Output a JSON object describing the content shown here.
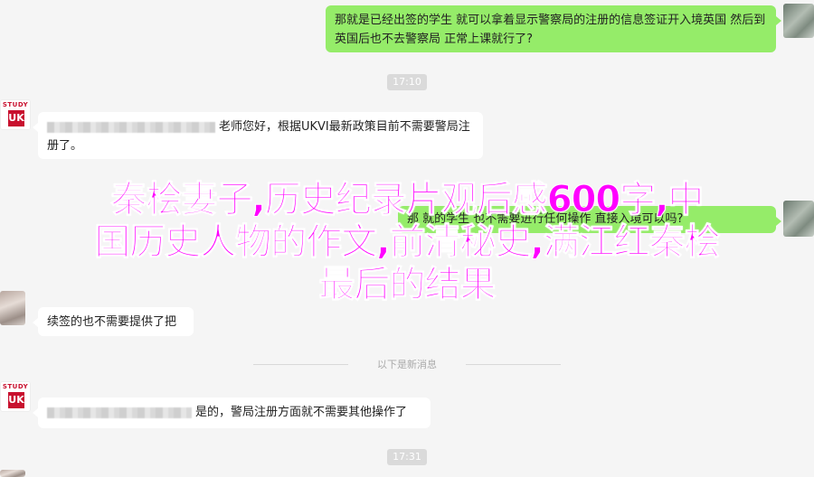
{
  "messages": {
    "m1": "那就是已经出签的学生 就可以拿着显示警察局的注册的信息签证开入境英国 然后到英国后也不去警察局 正常上课就行了?",
    "m2": "老师您好，根据UKVI最新政策目前不需要警局注册了。",
    "m3_partial_a": "那",
    "m3_partial_b": "就的学生",
    "m3_partial_c": "也不需要进行任何操作",
    "m3_partial_d": "直接入境可以吗?",
    "m4": "续签的也不需要提供了把",
    "m5": "是的，警局注册方面就不需要其他操作了"
  },
  "timestamps": {
    "t1": "17:10",
    "t2": "17:31"
  },
  "divider_label": "以下是新消息",
  "overlay_title": {
    "line1": "秦桧妻子,历史纪录片观后感600字,中",
    "line2": "国历史人物的作文,前清秘史,满江红秦桧",
    "line3": "最后的结果"
  },
  "avatar_labels": {
    "study": "STUDY",
    "uk": "UK"
  }
}
